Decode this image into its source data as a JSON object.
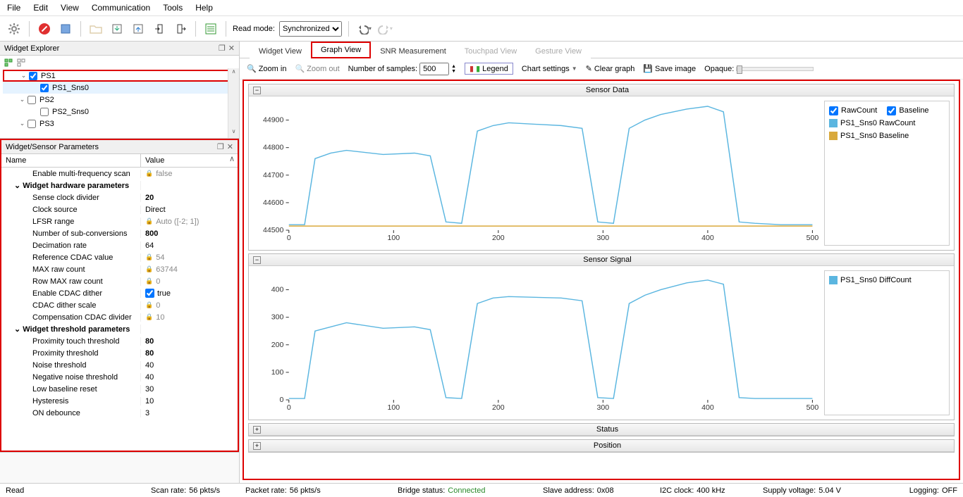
{
  "menu": {
    "items": [
      "File",
      "Edit",
      "View",
      "Communication",
      "Tools",
      "Help"
    ]
  },
  "toolbar": {
    "read_mode_label": "Read mode:",
    "read_mode_value": "Synchronized"
  },
  "widget_explorer": {
    "title": "Widget Explorer",
    "items": [
      {
        "label": "PS1",
        "checked": true,
        "expand": "open",
        "indent": 0,
        "hl": true
      },
      {
        "label": "PS1_Sns0",
        "checked": true,
        "indent": 1,
        "sel": true
      },
      {
        "label": "PS2",
        "checked": false,
        "expand": "open",
        "indent": 0
      },
      {
        "label": "PS2_Sns0",
        "checked": false,
        "indent": 1
      },
      {
        "label": "PS3",
        "checked": false,
        "expand": "open",
        "indent": 0
      }
    ]
  },
  "params_panel": {
    "title": "Widget/Sensor Parameters",
    "col1": "Name",
    "col2": "Value",
    "rows": [
      {
        "name": "Enable multi-frequency scan",
        "value": "false",
        "locked": true,
        "ind": 2
      },
      {
        "group": "Widget hardware parameters"
      },
      {
        "name": "Sense clock divider",
        "value": "20",
        "bold": true,
        "ind": 2
      },
      {
        "name": "Clock source",
        "value": "Direct",
        "ind": 2
      },
      {
        "name": "LFSR range",
        "value": "Auto ([-2; 1])",
        "locked": true,
        "ind": 2
      },
      {
        "name": "Number of sub-conversions",
        "value": "800",
        "bold": true,
        "ind": 2
      },
      {
        "name": "Decimation rate",
        "value": "64",
        "ind": 2
      },
      {
        "name": "Reference CDAC value",
        "value": "54",
        "locked": true,
        "ind": 2
      },
      {
        "name": "MAX raw count",
        "value": "63744",
        "locked": true,
        "ind": 2
      },
      {
        "name": "Row MAX raw count",
        "value": "0",
        "locked": true,
        "ind": 2
      },
      {
        "name": "Enable CDAC dither",
        "value": "true",
        "checkbox": true,
        "ind": 2
      },
      {
        "name": "CDAC dither scale",
        "value": "0",
        "locked": true,
        "ind": 2
      },
      {
        "name": "Compensation CDAC divider",
        "value": "10",
        "locked": true,
        "ind": 2
      },
      {
        "group": "Widget threshold parameters"
      },
      {
        "name": "Proximity touch threshold",
        "value": "80",
        "bold": true,
        "ind": 2
      },
      {
        "name": "Proximity threshold",
        "value": "80",
        "bold": true,
        "ind": 2
      },
      {
        "name": "Noise threshold",
        "value": "40",
        "ind": 2
      },
      {
        "name": "Negative noise threshold",
        "value": "40",
        "ind": 2
      },
      {
        "name": "Low baseline reset",
        "value": "30",
        "ind": 2
      },
      {
        "name": "Hysteresis",
        "value": "10",
        "ind": 2
      },
      {
        "name": "ON debounce",
        "value": "3",
        "ind": 2
      }
    ]
  },
  "tabs": [
    {
      "label": "Widget View"
    },
    {
      "label": "Graph View",
      "active": true
    },
    {
      "label": "SNR Measurement"
    },
    {
      "label": "Touchpad View",
      "disabled": true
    },
    {
      "label": "Gesture View",
      "disabled": true
    }
  ],
  "chart_toolbar": {
    "zoom_in": "Zoom in",
    "zoom_out": "Zoom out",
    "samples_label": "Number of samples:",
    "samples_value": "500",
    "legend": "Legend",
    "settings": "Chart settings",
    "clear": "Clear graph",
    "save": "Save image",
    "opaque": "Opaque:"
  },
  "charts": {
    "sensor_data": {
      "title": "Sensor Data",
      "legend": [
        {
          "label": "RawCount",
          "checkbox": true,
          "checked": true
        },
        {
          "label": "Baseline",
          "checkbox": true,
          "checked": true
        },
        {
          "label": "PS1_Sns0 RawCount",
          "color": "#5bb6e0"
        },
        {
          "label": "PS1_Sns0 Baseline",
          "color": "#d9a93c"
        }
      ]
    },
    "sensor_signal": {
      "title": "Sensor Signal",
      "legend": [
        {
          "label": "PS1_Sns0 DiffCount",
          "color": "#5bb6e0"
        }
      ]
    },
    "status": {
      "title": "Status"
    },
    "position": {
      "title": "Position"
    }
  },
  "chart_data": [
    {
      "type": "line",
      "title": "Sensor Data",
      "xlabel": "",
      "ylabel": "",
      "xlim": [
        0,
        500
      ],
      "ylim": [
        44500,
        44950
      ],
      "yticks": [
        44500,
        44600,
        44700,
        44800,
        44900
      ],
      "xticks": [
        0,
        100,
        200,
        300,
        400,
        500
      ],
      "series": [
        {
          "name": "PS1_Sns0 RawCount",
          "color": "#5bb6e0",
          "x": [
            0,
            15,
            25,
            40,
            55,
            90,
            120,
            135,
            150,
            165,
            180,
            195,
            210,
            260,
            280,
            295,
            310,
            325,
            340,
            355,
            380,
            400,
            415,
            430,
            445,
            470,
            500
          ],
          "y": [
            44520,
            44520,
            44760,
            44780,
            44790,
            44775,
            44780,
            44770,
            44530,
            44525,
            44860,
            44880,
            44890,
            44880,
            44870,
            44530,
            44525,
            44870,
            44900,
            44920,
            44940,
            44950,
            44930,
            44530,
            44525,
            44520,
            44520
          ]
        },
        {
          "name": "PS1_Sns0 Baseline",
          "color": "#d9a93c",
          "x": [
            0,
            500
          ],
          "y": [
            44515,
            44515
          ]
        }
      ]
    },
    {
      "type": "line",
      "title": "Sensor Signal",
      "xlabel": "",
      "ylabel": "",
      "xlim": [
        0,
        500
      ],
      "ylim": [
        0,
        450
      ],
      "yticks": [
        0,
        100,
        200,
        300,
        400
      ],
      "xticks": [
        0,
        100,
        200,
        300,
        400,
        500
      ],
      "series": [
        {
          "name": "PS1_Sns0 DiffCount",
          "color": "#5bb6e0",
          "x": [
            0,
            15,
            25,
            40,
            55,
            90,
            120,
            135,
            150,
            165,
            180,
            195,
            210,
            260,
            280,
            295,
            310,
            325,
            340,
            355,
            380,
            400,
            415,
            430,
            445,
            470,
            500
          ],
          "y": [
            5,
            5,
            250,
            265,
            280,
            260,
            265,
            255,
            8,
            5,
            350,
            370,
            375,
            370,
            360,
            8,
            5,
            350,
            380,
            400,
            425,
            435,
            420,
            8,
            5,
            5,
            5
          ]
        }
      ]
    }
  ],
  "statusbar": {
    "read": "Read",
    "scan_rate_label": "Scan rate:",
    "scan_rate": "56 pkts/s",
    "packet_rate_label": "Packet rate:",
    "packet_rate": "56 pkts/s",
    "bridge_label": "Bridge status:",
    "bridge": "Connected",
    "slave_label": "Slave address:",
    "slave": "0x08",
    "i2c_label": "I2C clock:",
    "i2c": "400 kHz",
    "supply_label": "Supply voltage:",
    "supply": "5.04 V",
    "log_label": "Logging:",
    "log": "OFF"
  }
}
